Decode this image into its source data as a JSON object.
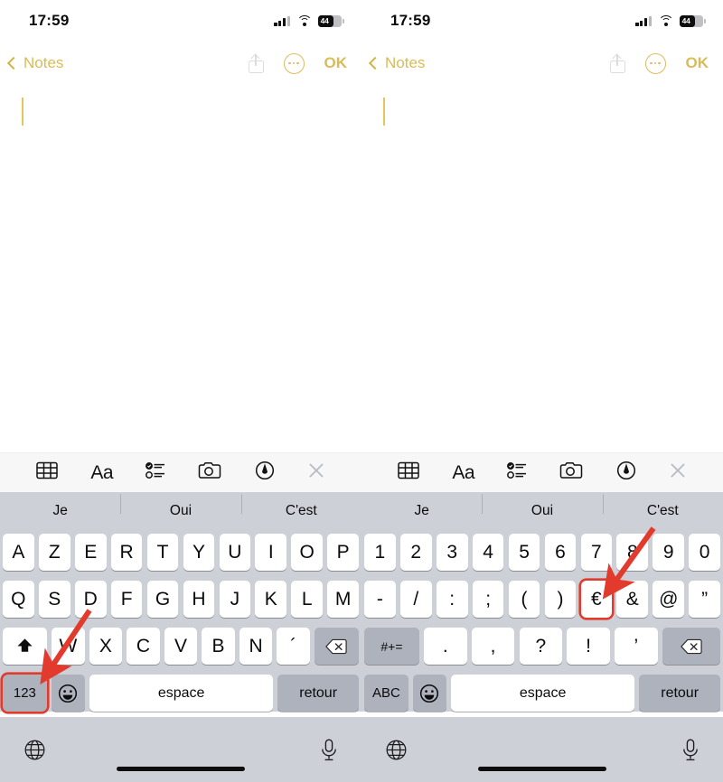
{
  "screens": [
    {
      "id": "left",
      "status": {
        "time": "17:59",
        "battery_level": "44",
        "signal_icon": "cellular-signal-icon",
        "wifi_icon": "wifi-icon",
        "battery_icon": "battery-icon"
      },
      "navbar": {
        "back_label": "Notes",
        "back_icon": "chevron-left-icon",
        "share_icon": "share-icon",
        "more_icon": "more-circle-icon",
        "done_label": "OK"
      },
      "toolbar": [
        {
          "name": "table-icon",
          "label": ""
        },
        {
          "name": "text-format-icon",
          "label": "Aa"
        },
        {
          "name": "checklist-icon",
          "label": ""
        },
        {
          "name": "camera-icon",
          "label": ""
        },
        {
          "name": "markup-pen-icon",
          "label": ""
        },
        {
          "name": "close-icon",
          "label": ""
        }
      ],
      "predictions": [
        "Je",
        "Oui",
        "C'est"
      ],
      "keyboard": {
        "mode": "letters",
        "rows": [
          [
            {
              "label": "A"
            },
            {
              "label": "Z"
            },
            {
              "label": "E"
            },
            {
              "label": "R"
            },
            {
              "label": "T"
            },
            {
              "label": "Y"
            },
            {
              "label": "U"
            },
            {
              "label": "I"
            },
            {
              "label": "O"
            },
            {
              "label": "P"
            }
          ],
          [
            {
              "label": "Q"
            },
            {
              "label": "S"
            },
            {
              "label": "D"
            },
            {
              "label": "F"
            },
            {
              "label": "G"
            },
            {
              "label": "H"
            },
            {
              "label": "J"
            },
            {
              "label": "K"
            },
            {
              "label": "L"
            },
            {
              "label": "M"
            }
          ],
          [
            {
              "label": "",
              "name": "shift-key",
              "icon": "shift-icon",
              "dark": false,
              "wide": true
            },
            {
              "label": "W"
            },
            {
              "label": "X"
            },
            {
              "label": "C"
            },
            {
              "label": "V"
            },
            {
              "label": "B"
            },
            {
              "label": "N"
            },
            {
              "label": "´"
            },
            {
              "label": "",
              "name": "delete-key",
              "icon": "delete-icon",
              "dark": true,
              "wide": true
            }
          ],
          [
            {
              "label": "123",
              "name": "numeric-mode-key",
              "dark": true,
              "highlight": true
            },
            {
              "label": "",
              "name": "emoji-key",
              "icon": "emoji-icon",
              "dark": true
            },
            {
              "label": "espace",
              "name": "space-key"
            },
            {
              "label": "retour",
              "name": "return-key",
              "dark": true
            }
          ]
        ]
      },
      "bottom": {
        "globe_icon": "globe-icon",
        "mic_icon": "microphone-icon",
        "home_indicator": "home-indicator"
      }
    },
    {
      "id": "right",
      "status": {
        "time": "17:59",
        "battery_level": "44",
        "signal_icon": "cellular-signal-icon",
        "wifi_icon": "wifi-icon",
        "battery_icon": "battery-icon"
      },
      "navbar": {
        "back_label": "Notes",
        "back_icon": "chevron-left-icon",
        "share_icon": "share-icon",
        "more_icon": "more-circle-icon",
        "done_label": "OK"
      },
      "toolbar": [
        {
          "name": "table-icon",
          "label": ""
        },
        {
          "name": "text-format-icon",
          "label": "Aa"
        },
        {
          "name": "checklist-icon",
          "label": ""
        },
        {
          "name": "camera-icon",
          "label": ""
        },
        {
          "name": "markup-pen-icon",
          "label": ""
        },
        {
          "name": "close-icon",
          "label": ""
        }
      ],
      "predictions": [
        "Je",
        "Oui",
        "C'est"
      ],
      "keyboard": {
        "mode": "numbers",
        "rows": [
          [
            {
              "label": "1"
            },
            {
              "label": "2"
            },
            {
              "label": "3"
            },
            {
              "label": "4"
            },
            {
              "label": "5"
            },
            {
              "label": "6"
            },
            {
              "label": "7"
            },
            {
              "label": "8"
            },
            {
              "label": "9"
            },
            {
              "label": "0"
            }
          ],
          [
            {
              "label": "-"
            },
            {
              "label": "/"
            },
            {
              "label": ":"
            },
            {
              "label": ";"
            },
            {
              "label": "("
            },
            {
              "label": ")"
            },
            {
              "label": "€",
              "name": "euro-key",
              "highlight": true
            },
            {
              "label": "&"
            },
            {
              "label": "@"
            },
            {
              "label": "”"
            }
          ],
          [
            {
              "label": "#+=",
              "name": "symbols-mode-key",
              "dark": true,
              "wide": true,
              "small": true
            },
            {
              "label": "."
            },
            {
              "label": ","
            },
            {
              "label": "?"
            },
            {
              "label": "!"
            },
            {
              "label": "’"
            },
            {
              "label": "",
              "name": "delete-key",
              "icon": "delete-icon",
              "dark": true,
              "wide": true
            }
          ],
          [
            {
              "label": "ABC",
              "name": "alpha-mode-key",
              "dark": true
            },
            {
              "label": "",
              "name": "emoji-key",
              "icon": "emoji-icon",
              "dark": true
            },
            {
              "label": "espace",
              "name": "space-key"
            },
            {
              "label": "retour",
              "name": "return-key",
              "dark": true
            }
          ]
        ]
      },
      "bottom": {
        "globe_icon": "globe-icon",
        "mic_icon": "microphone-icon",
        "home_indicator": "home-indicator"
      }
    }
  ],
  "annotations": {
    "color": "#e23b2e",
    "arrows": [
      {
        "name": "arrow-to-numeric-key",
        "target": "123"
      },
      {
        "name": "arrow-to-euro-key",
        "target": "€"
      }
    ],
    "highlight_boxes": [
      {
        "name": "highlight-numeric-key",
        "target": "123"
      },
      {
        "name": "highlight-euro-key",
        "target": "€"
      }
    ]
  }
}
